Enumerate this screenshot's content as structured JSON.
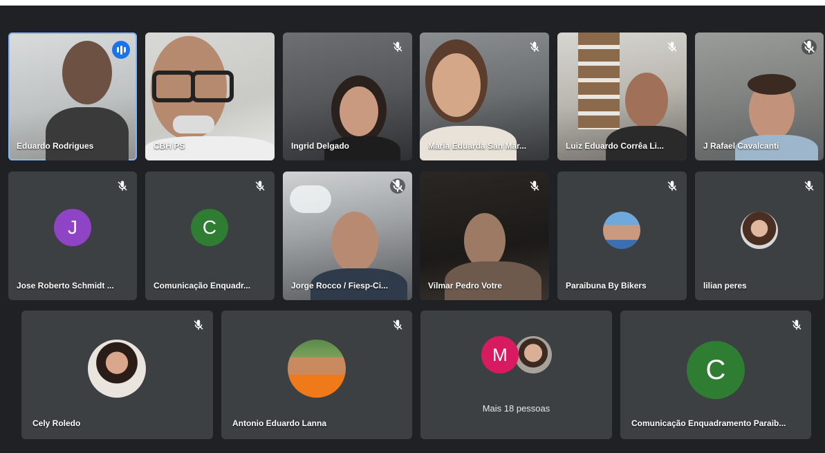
{
  "colors": {
    "stage_bg": "#202124",
    "tile_bg": "#3c4043",
    "active_border": "#8ab4f8",
    "speaking_badge": "#1a73e8",
    "avatar_purple": "#8e44c4",
    "avatar_green": "#2e7d32",
    "avatar_pink": "#d81b60"
  },
  "participants": [
    {
      "name": "Eduardo Rodrigues",
      "type": "video",
      "speaking": true,
      "icon": "speaking-indicator-icon"
    },
    {
      "name": "CBH PS",
      "type": "video",
      "icon": "none"
    },
    {
      "name": "Ingrid Delgado",
      "type": "video",
      "icon": "mic-off-icon"
    },
    {
      "name": "Maria Eduarda San Mar...",
      "type": "video",
      "icon": "mic-off-icon"
    },
    {
      "name": "Luiz Eduardo Corrêa Li...",
      "type": "video",
      "icon": "mic-off-icon"
    },
    {
      "name": "J Rafael Cavalcanti",
      "type": "video",
      "icon": "mic-off-icon"
    },
    {
      "name": "Jose Roberto Schmidt ...",
      "type": "avatar",
      "initial": "J",
      "icon": "mic-off-icon"
    },
    {
      "name": "Comunicação Enquadr...",
      "type": "avatar",
      "initial": "C",
      "icon": "mic-off-icon"
    },
    {
      "name": "Jorge Rocco / Fiesp-Ci...",
      "type": "video",
      "icon": "mic-off-icon"
    },
    {
      "name": "Vilmar Pedro Votre",
      "type": "video",
      "icon": "mic-off-icon"
    },
    {
      "name": "Paraibuna By Bikers",
      "type": "photo",
      "icon": "mic-off-icon"
    },
    {
      "name": "lilian peres",
      "type": "photo",
      "icon": "mic-off-icon"
    },
    {
      "name": "Cely Roledo",
      "type": "photo",
      "icon": "mic-off-icon"
    },
    {
      "name": "Antonio Eduardo Lanna",
      "type": "photo",
      "icon": "mic-off-icon"
    },
    {
      "name": "Mais 18 pessoas",
      "type": "overflow",
      "initial": "M"
    },
    {
      "name": "Comunicação Enquadramento Paraib...",
      "type": "avatar",
      "initial": "C",
      "icon": "mic-off-icon"
    }
  ]
}
